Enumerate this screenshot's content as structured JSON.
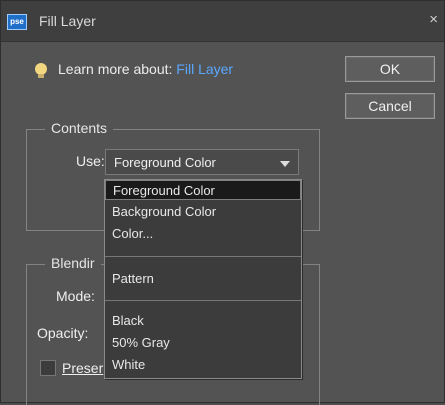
{
  "window": {
    "title": "Fill Layer",
    "app_icon_text": "pse",
    "close_glyph": "×"
  },
  "help": {
    "prefix": "Learn more about: ",
    "link": "Fill Layer"
  },
  "buttons": {
    "ok": "OK",
    "cancel": "Cancel"
  },
  "contents": {
    "legend": "Contents",
    "use_label": "Use:",
    "use_value": "Foreground Color",
    "dropdown_groups": [
      [
        "Foreground Color",
        "Background Color",
        "Color..."
      ],
      [
        "Pattern"
      ],
      [
        "Black",
        "50% Gray",
        "White"
      ]
    ],
    "selected_item": "Foreground Color"
  },
  "blending": {
    "legend_visible": "Blendir",
    "mode_label": "Mode:",
    "opacity_label": "Opacity:",
    "preserve_label_visible": "Preser"
  },
  "colors": {
    "link": "#5aa7ff",
    "selection": "#1a1a1a"
  }
}
